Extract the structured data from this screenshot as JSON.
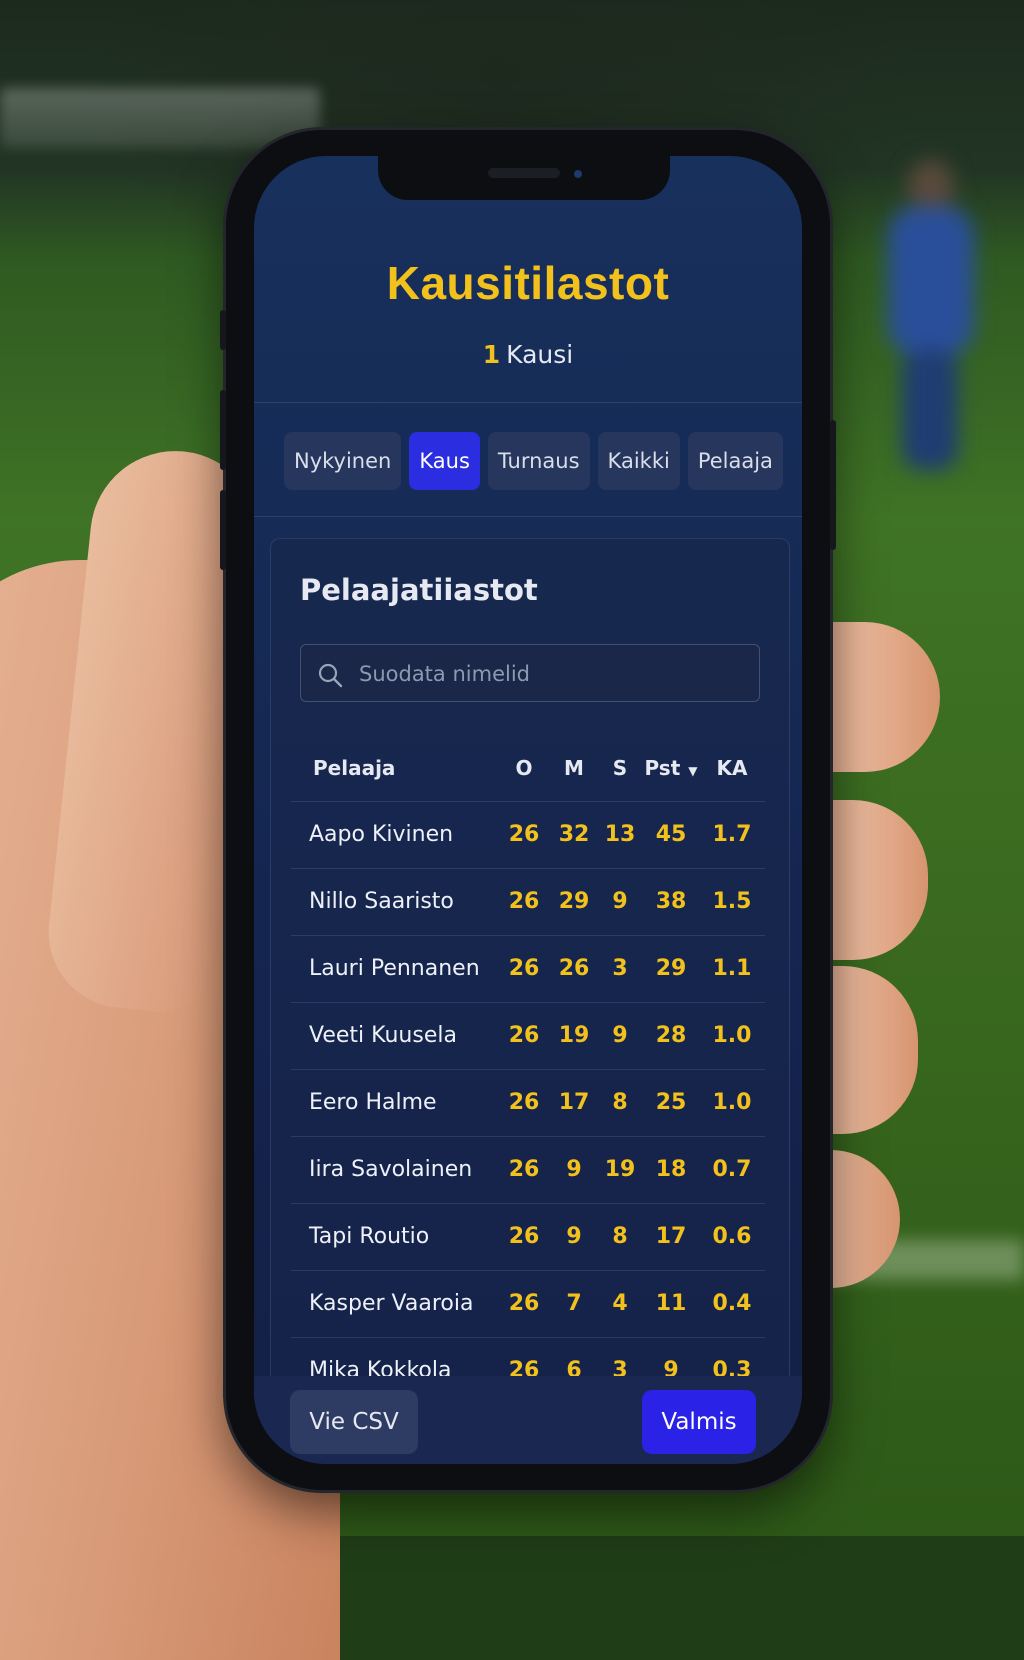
{
  "header": {
    "title": "Kausitilastot",
    "subtitle_num": "1",
    "subtitle_text": "Kausi"
  },
  "tabs": [
    {
      "label": "Nykyinen",
      "active": false
    },
    {
      "label": "Kaus",
      "active": true
    },
    {
      "label": "Turnaus",
      "active": false
    },
    {
      "label": "Kaikki",
      "active": false
    },
    {
      "label": "Pelaaja",
      "active": false
    }
  ],
  "card": {
    "title": "Pelaajatiiastot",
    "search_placeholder": "Suodata nimelid"
  },
  "table": {
    "headers": {
      "name": "Pelaaja",
      "o": "O",
      "m": "M",
      "s": "S",
      "pst": "Pst",
      "ka": "KA"
    },
    "sorted_column": "pst",
    "rows": [
      {
        "name": "Aapo Kivinen",
        "o": "26",
        "m": "32",
        "s": "13",
        "pst": "45",
        "ka": "1.7"
      },
      {
        "name": "Nillo Saaristo",
        "o": "26",
        "m": "29",
        "s": "9",
        "pst": "38",
        "ka": "1.5"
      },
      {
        "name": "Lauri Pennanen",
        "o": "26",
        "m": "26",
        "s": "3",
        "pst": "29",
        "ka": "1.1"
      },
      {
        "name": "Veeti Kuusela",
        "o": "26",
        "m": "19",
        "s": "9",
        "pst": "28",
        "ka": "1.0"
      },
      {
        "name": "Eero Halme",
        "o": "26",
        "m": "17",
        "s": "8",
        "pst": "25",
        "ka": "1.0"
      },
      {
        "name": "Iira Savolainen",
        "o": "26",
        "m": "9",
        "s": "19",
        "pst": "18",
        "ka": "0.7"
      },
      {
        "name": "Tapi Routio",
        "o": "26",
        "m": "9",
        "s": "8",
        "pst": "17",
        "ka": "0.6"
      },
      {
        "name": "Kasper Vaaroia",
        "o": "26",
        "m": "7",
        "s": "4",
        "pst": "11",
        "ka": "0.4"
      },
      {
        "name": "Mika Kokkola",
        "o": "26",
        "m": "6",
        "s": "3",
        "pst": "9",
        "ka": "0.3"
      }
    ]
  },
  "footer": {
    "export_label": "Vie CSV",
    "done_label": "Valmis"
  },
  "colors": {
    "accent_yellow": "#f2c11c",
    "primary_blue": "#2a2de0",
    "screen_bg": "#152a55"
  },
  "icons": {
    "search": "search-icon",
    "sort": "caret-down-icon"
  }
}
